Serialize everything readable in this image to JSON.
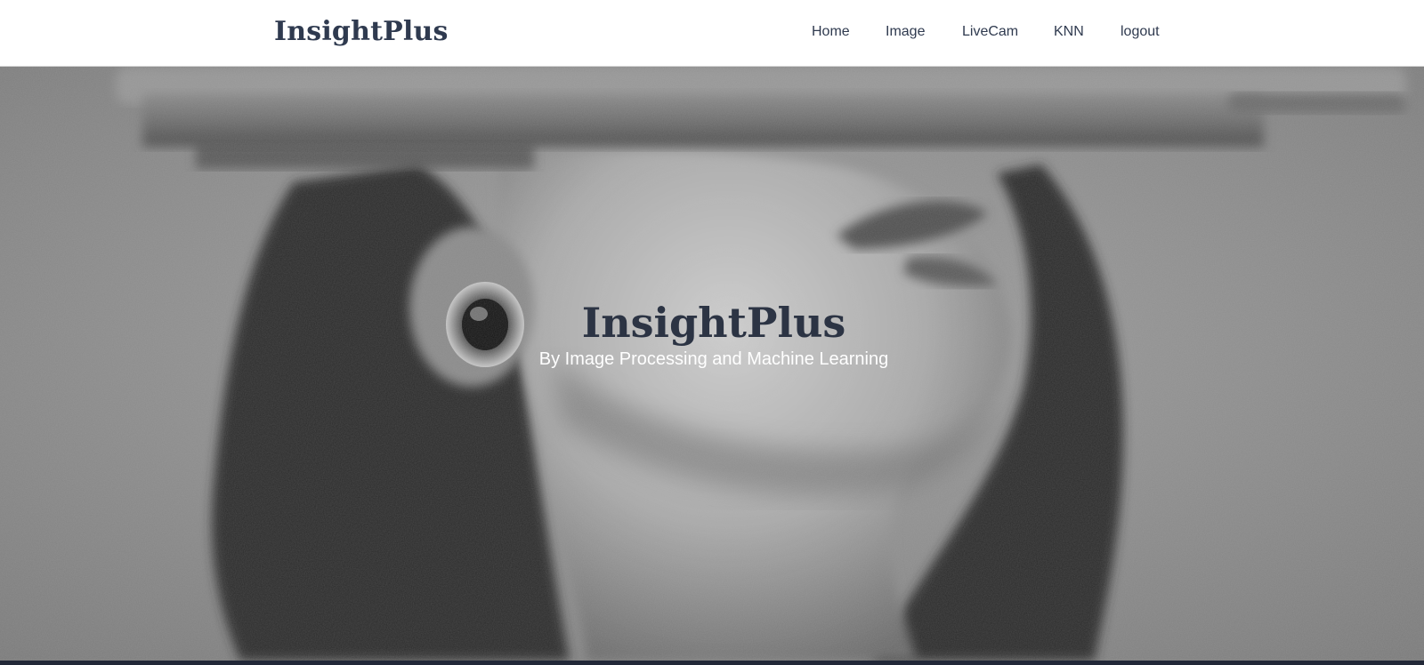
{
  "navbar": {
    "brand": "InsightPlus",
    "links": [
      {
        "label": "Home"
      },
      {
        "label": "Image"
      },
      {
        "label": "LiveCam"
      },
      {
        "label": "KNN"
      },
      {
        "label": "logout"
      }
    ]
  },
  "hero": {
    "title": "InsightPlus",
    "subtitle": "By Image Processing and Machine Learning",
    "background_image": "grayscale-portrait-photo"
  },
  "colors": {
    "brand_text": "#2f3a4f",
    "hero_title": "#2c3444",
    "hero_subtitle": "#ffffff",
    "footer": "#222838"
  }
}
